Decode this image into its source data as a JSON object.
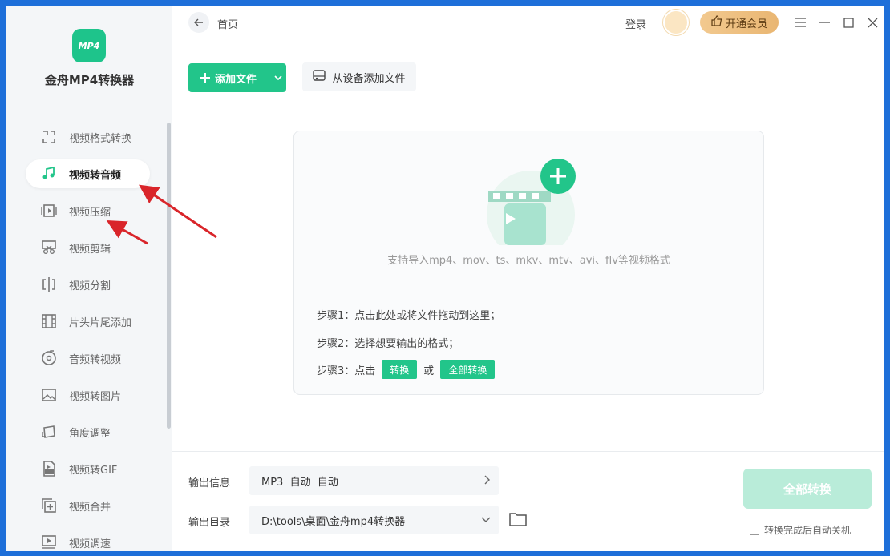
{
  "app": {
    "name": "金舟MP4转换器",
    "logo_text": "MP4"
  },
  "sidebar": {
    "items": [
      {
        "label": "视频格式转换",
        "icon": "video-format-icon"
      },
      {
        "label": "视频转音频",
        "icon": "music-note-icon",
        "active": true
      },
      {
        "label": "视频压缩",
        "icon": "compress-icon"
      },
      {
        "label": "视频剪辑",
        "icon": "scissors-icon"
      },
      {
        "label": "视频分割",
        "icon": "split-icon"
      },
      {
        "label": "片头片尾添加",
        "icon": "film-strip-icon"
      },
      {
        "label": "音频转视频",
        "icon": "audio-disc-icon"
      },
      {
        "label": "视频转图片",
        "icon": "image-icon"
      },
      {
        "label": "角度调整",
        "icon": "rotate-icon"
      },
      {
        "label": "视频转GIF",
        "icon": "gif-icon"
      },
      {
        "label": "视频合并",
        "icon": "merge-icon"
      },
      {
        "label": "视频调速",
        "icon": "speed-icon"
      }
    ]
  },
  "topbar": {
    "breadcrumb": "首页",
    "login": "登录",
    "vip": "开通会员"
  },
  "toolbar": {
    "add_file": "添加文件",
    "add_from_device": "从设备添加文件"
  },
  "dropzone": {
    "support_text": "支持导入mp4、mov、ts、mkv、mtv、avi、flv等视频格式",
    "step1": "步骤1：点击此处或将文件拖动到这里；",
    "step2": "步骤2：选择想要输出的格式；",
    "step3_prefix": "步骤3：点击",
    "step3_convert": "转换",
    "step3_or": "或",
    "step3_convert_all": "全部转换"
  },
  "output": {
    "info_label": "输出信息",
    "info_value": "MP3  自动  自动",
    "dir_label": "输出目录",
    "dir_value": "D:\\tools\\桌面\\金舟mp4转换器"
  },
  "actions": {
    "convert_all": "全部转换",
    "shutdown_label": "转换完成后自动关机"
  },
  "colors": {
    "accent": "#22c58a",
    "vip": "#e9b672",
    "annotation": "#d9252a"
  }
}
